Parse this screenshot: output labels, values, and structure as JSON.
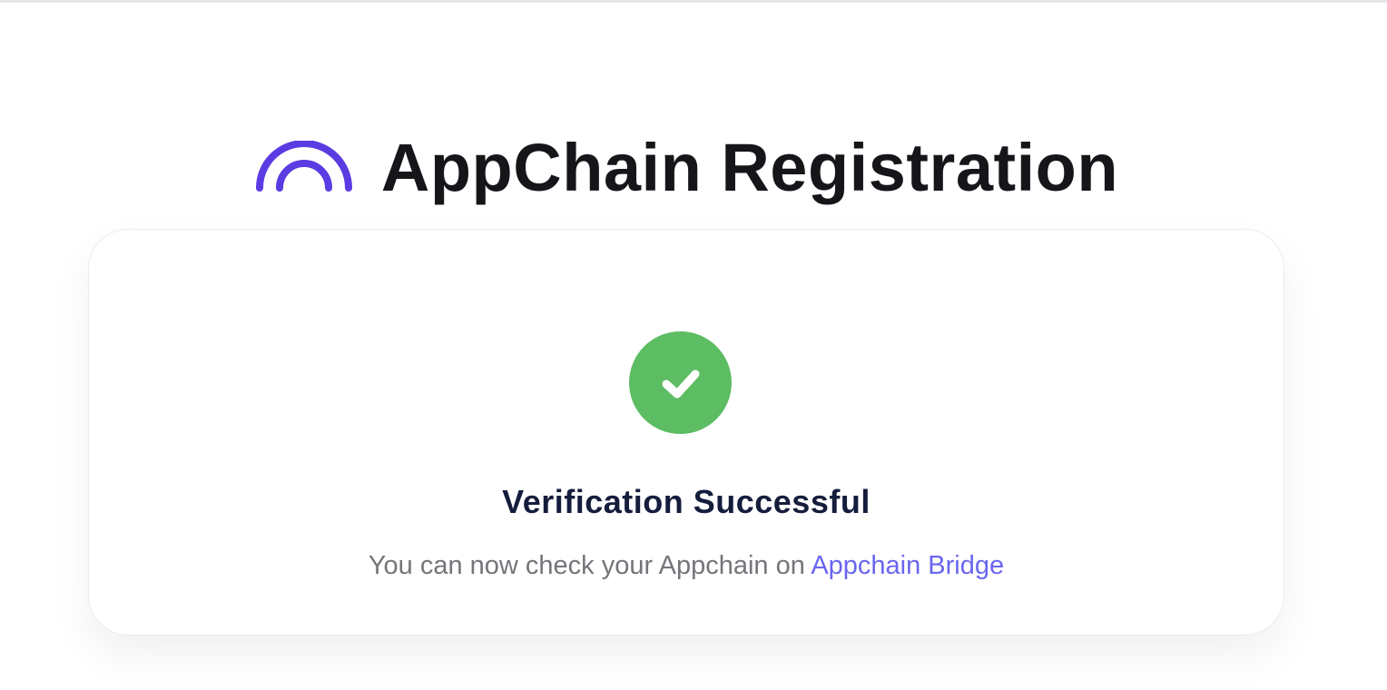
{
  "header": {
    "title": "AppChain Registration",
    "logo_icon": "arc-logo-icon",
    "logo_color": "#5b3be2"
  },
  "status": {
    "icon": "check-circle-icon",
    "icon_color": "#5cbd63",
    "title": "Verification Successful",
    "message": "You can now check your Appchain on",
    "link_label": "Appchain Bridge",
    "link_color": "#6a66f0"
  }
}
